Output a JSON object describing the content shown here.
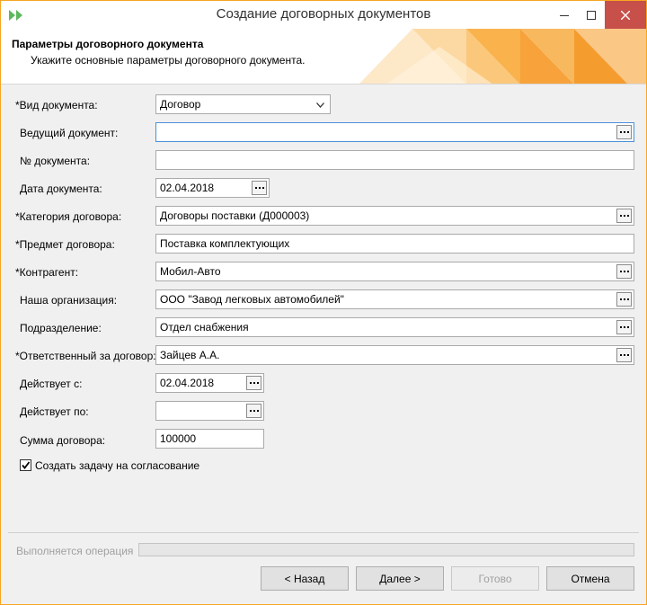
{
  "window": {
    "title": "Создание договорных документов",
    "accent": "#f5a623"
  },
  "header": {
    "title": "Параметры договорного документа",
    "subtitle": "Укажите основные параметры договорного документа."
  },
  "form": {
    "doc_type": {
      "label": "*Вид документа:",
      "value": "Договор"
    },
    "lead_doc": {
      "label": "Ведущий документ:",
      "value": ""
    },
    "doc_number": {
      "label": "№ документа:",
      "value": ""
    },
    "doc_date": {
      "label": "Дата документа:",
      "value": "02.04.2018"
    },
    "category": {
      "label": "*Категория договора:",
      "value": "Договоры поставки (Д000003)"
    },
    "subject": {
      "label": "*Предмет договора:",
      "value": "Поставка комплектующих"
    },
    "counterparty": {
      "label": "*Контрагент:",
      "value": "Мобил-Авто"
    },
    "our_org": {
      "label": "Наша организация:",
      "value": "ООО \"Завод легковых автомобилей\""
    },
    "department": {
      "label": "Подразделение:",
      "value": "Отдел снабжения"
    },
    "responsible": {
      "label": "*Ответственный за договор:",
      "value": "Зайцев А.А."
    },
    "valid_from": {
      "label": "Действует с:",
      "value": "02.04.2018"
    },
    "valid_to": {
      "label": "Действует по:",
      "value": ""
    },
    "amount": {
      "label": "Сумма договора:",
      "value": "100000"
    },
    "create_task": {
      "label": "Создать задачу на согласование",
      "checked": true
    }
  },
  "footer": {
    "progress_label": "Выполняется операция",
    "progress": 0,
    "back": "< Назад",
    "next": "Далее >",
    "done": "Готово",
    "cancel": "Отмена"
  }
}
